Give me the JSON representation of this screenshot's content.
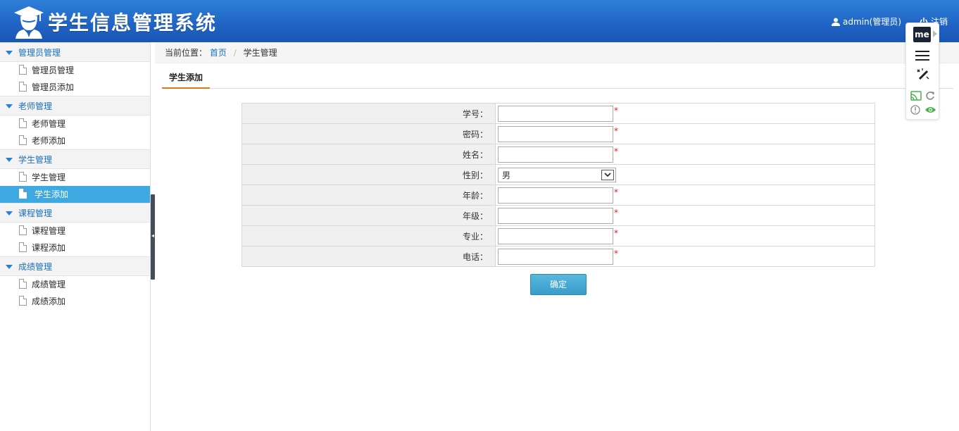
{
  "header": {
    "title": "学生信息管理系统",
    "user": "admin(管理员)",
    "logout": "注销"
  },
  "sidebar": {
    "groups": [
      {
        "label": "管理员管理",
        "items": [
          {
            "label": "管理员管理"
          },
          {
            "label": "管理员添加"
          }
        ]
      },
      {
        "label": "老师管理",
        "items": [
          {
            "label": "老师管理"
          },
          {
            "label": "老师添加"
          }
        ]
      },
      {
        "label": "学生管理",
        "items": [
          {
            "label": "学生管理"
          },
          {
            "label": "学生添加",
            "active": true
          }
        ]
      },
      {
        "label": "课程管理",
        "items": [
          {
            "label": "课程管理"
          },
          {
            "label": "课程添加"
          }
        ]
      },
      {
        "label": "成绩管理",
        "items": [
          {
            "label": "成绩管理"
          },
          {
            "label": "成绩添加"
          }
        ]
      }
    ]
  },
  "breadcrumb": {
    "prefix": "当前位置：",
    "home": "首页",
    "separator": "/",
    "current": "学生管理"
  },
  "tab": {
    "label": "学生添加"
  },
  "form": {
    "fields": [
      {
        "label": "学号：",
        "value": "",
        "required": true
      },
      {
        "label": "密码：",
        "value": "",
        "required": true
      },
      {
        "label": "姓名：",
        "value": "",
        "required": true
      },
      {
        "label": "性别：",
        "value": "男",
        "type": "select"
      },
      {
        "label": "年龄：",
        "value": "",
        "required": true
      },
      {
        "label": "年级：",
        "value": "",
        "required": true
      },
      {
        "label": "专业：",
        "value": "",
        "required": true
      },
      {
        "label": "电话：",
        "value": "",
        "required": true
      }
    ],
    "required_mark": "*",
    "submit": "确定"
  },
  "extension": {
    "badge": "me"
  },
  "colors": {
    "header": "#2167c8",
    "accent": "#3ea9e0",
    "link": "#1a6fbf",
    "tab_underline": "#e3741c",
    "required": "#e02020"
  }
}
